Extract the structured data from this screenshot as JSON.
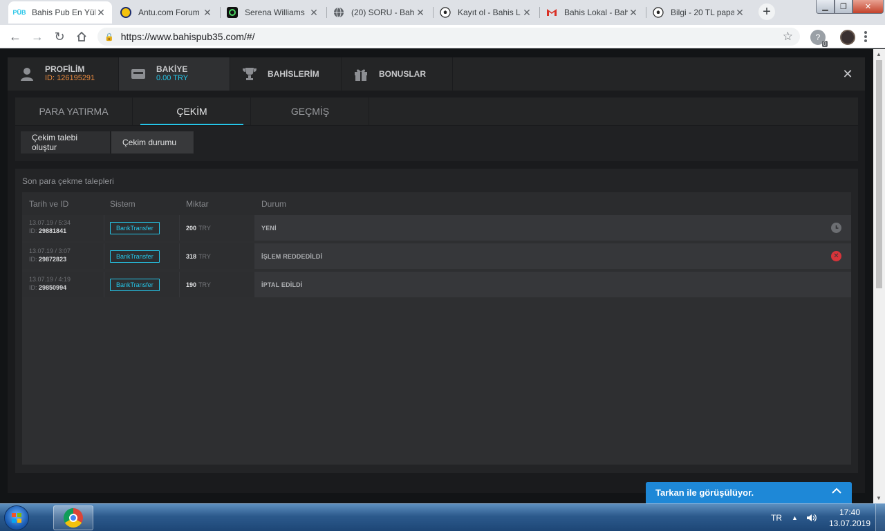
{
  "browser": {
    "tabs": [
      {
        "title": "Bahis Pub En Yük",
        "favicon": "pub-logo",
        "active": true
      },
      {
        "title": "Antu.com Forum",
        "favicon": "fenerbahce-icon"
      },
      {
        "title": "Serena Williams",
        "favicon": "c-logo-icon"
      },
      {
        "title": "(20) SORU - Bahi",
        "favicon": "globe-icon"
      },
      {
        "title": "Kayıt ol - Bahis L",
        "favicon": "soccer-ball-icon"
      },
      {
        "title": "Bahis Lokal - Bah",
        "favicon": "gmail-icon"
      },
      {
        "title": "Bilgi - 20 TL papa",
        "favicon": "soccer-ball-icon"
      }
    ],
    "pub_favicon_text": "PÜB",
    "url": "https://www.bahispub35.com/#/",
    "extension_badge": "0"
  },
  "modal": {
    "top_tabs": [
      {
        "label": "PROFİLİM",
        "sub": "ID: 126195291",
        "icon": "user-icon"
      },
      {
        "label": "BAKİYE",
        "sub": "0.00 TRY",
        "icon": "wallet-icon"
      },
      {
        "label": "BAHİSLERİM",
        "sub": "",
        "icon": "trophy-icon"
      },
      {
        "label": "BONUSLAR",
        "sub": "",
        "icon": "gift-icon"
      }
    ],
    "sub_tabs": [
      "PARA YATIRMA",
      "ÇEKİM",
      "GEÇMİŞ"
    ],
    "actions": [
      "Çekim talebi oluştur",
      "Çekim durumu"
    ],
    "panel_title": "Son para çekme talepleri",
    "columns": [
      "Tarih ve ID",
      "Sistem",
      "Miktar",
      "Durum"
    ],
    "rows": [
      {
        "date": "13.07.19 / 5:34",
        "id_label": "ID:",
        "id": "29881841",
        "system": "BankTransfer",
        "amount": "200",
        "currency": "TRY",
        "status": "YENİ",
        "status_icon": "clock-icon"
      },
      {
        "date": "13.07.19 / 3:07",
        "id_label": "ID:",
        "id": "29872823",
        "system": "BankTransfer",
        "amount": "318",
        "currency": "TRY",
        "status": "İŞLEM REDDEDİLDİ",
        "status_icon": "rejected-icon"
      },
      {
        "date": "13.07.19 / 4:19",
        "id_label": "ID:",
        "id": "29850994",
        "system": "BankTransfer",
        "amount": "190",
        "currency": "TRY",
        "status": "İPTAL EDİLDİ",
        "status_icon": ""
      }
    ]
  },
  "chat": {
    "text": "Tarkan ile görüşülüyor."
  },
  "taskbar": {
    "language": "TR",
    "time": "17:40",
    "date": "13.07.2019"
  },
  "colors": {
    "accent": "#25c5e8",
    "id_orange": "#e98a3e",
    "rejected_red": "#d8343a",
    "chat_blue": "#1e88d7"
  }
}
